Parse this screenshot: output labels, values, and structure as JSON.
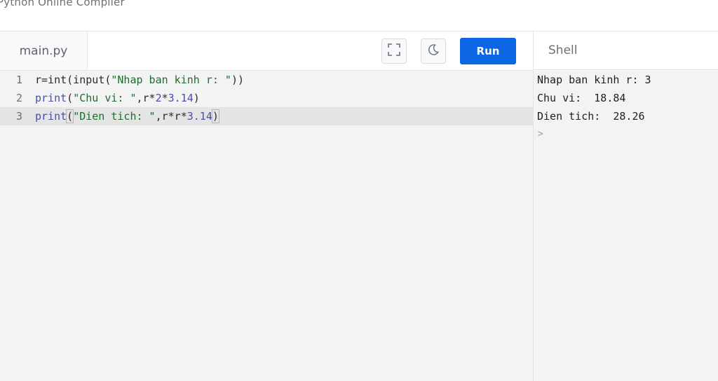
{
  "page": {
    "heading": "Python Online Compiler"
  },
  "toolbar": {
    "file_tab_label": "main.py",
    "fullscreen_icon": "fullscreen-icon",
    "theme_icon": "moon-icon",
    "run_label": "Run",
    "accent_color": "#0c66e4"
  },
  "editor": {
    "lines": [
      {
        "number": "1",
        "tokens": [
          {
            "t": "r=int(input(",
            "c": "plain"
          },
          {
            "t": "\"Nhap ban kinh r: \"",
            "c": "str"
          },
          {
            "t": "))",
            "c": "plain"
          }
        ]
      },
      {
        "number": "2",
        "tokens": [
          {
            "t": "print",
            "c": "kw"
          },
          {
            "t": "(",
            "c": "plain"
          },
          {
            "t": "\"Chu vi: \"",
            "c": "str"
          },
          {
            "t": ",r*",
            "c": "plain"
          },
          {
            "t": "2",
            "c": "num"
          },
          {
            "t": "*",
            "c": "plain"
          },
          {
            "t": "3.14",
            "c": "num"
          },
          {
            "t": ")",
            "c": "plain"
          }
        ]
      },
      {
        "number": "3",
        "active": true,
        "tokens": [
          {
            "t": "print",
            "c": "kw"
          },
          {
            "t": "(",
            "c": "plain",
            "hl": true
          },
          {
            "t": "\"Dien tich: \"",
            "c": "str"
          },
          {
            "t": ",r*r*",
            "c": "plain"
          },
          {
            "t": "3.14",
            "c": "num"
          },
          {
            "t": ")",
            "c": "plain",
            "hl": true
          }
        ]
      }
    ]
  },
  "shell": {
    "title": "Shell",
    "output": [
      "Nhap ban kinh r: 3",
      "Chu vi:  18.84",
      "Dien tich:  28.26"
    ],
    "prompt": ">"
  }
}
